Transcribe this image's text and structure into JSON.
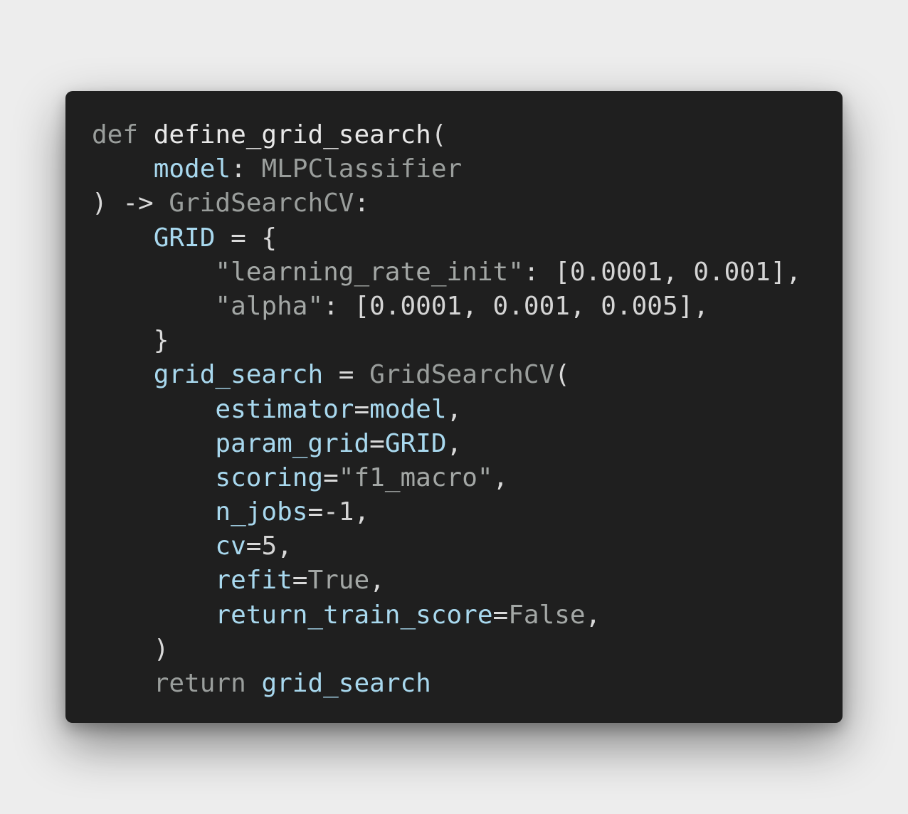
{
  "code_lines": [
    [
      {
        "t": "def",
        "c": "kw"
      },
      {
        "t": " ",
        "c": "punc"
      },
      {
        "t": "define_grid_search",
        "c": "fn"
      },
      {
        "t": "(",
        "c": "punc"
      }
    ],
    [
      {
        "t": "    ",
        "c": "punc"
      },
      {
        "t": "model",
        "c": "var"
      },
      {
        "t": ": ",
        "c": "punc"
      },
      {
        "t": "MLPClassifier",
        "c": "type"
      }
    ],
    [
      {
        "t": ") -> ",
        "c": "punc"
      },
      {
        "t": "GridSearchCV",
        "c": "type"
      },
      {
        "t": ":",
        "c": "punc"
      }
    ],
    [
      {
        "t": "    ",
        "c": "punc"
      },
      {
        "t": "GRID",
        "c": "var"
      },
      {
        "t": " = {",
        "c": "punc"
      }
    ],
    [
      {
        "t": "        ",
        "c": "punc"
      },
      {
        "t": "\"learning_rate_init\"",
        "c": "str"
      },
      {
        "t": ": [",
        "c": "punc"
      },
      {
        "t": "0.0001",
        "c": "num"
      },
      {
        "t": ", ",
        "c": "punc"
      },
      {
        "t": "0.001",
        "c": "num"
      },
      {
        "t": "],",
        "c": "punc"
      }
    ],
    [
      {
        "t": "        ",
        "c": "punc"
      },
      {
        "t": "\"alpha\"",
        "c": "str"
      },
      {
        "t": ": [",
        "c": "punc"
      },
      {
        "t": "0.0001",
        "c": "num"
      },
      {
        "t": ", ",
        "c": "punc"
      },
      {
        "t": "0.001",
        "c": "num"
      },
      {
        "t": ", ",
        "c": "punc"
      },
      {
        "t": "0.005",
        "c": "num"
      },
      {
        "t": "],",
        "c": "punc"
      }
    ],
    [
      {
        "t": "    }",
        "c": "punc"
      }
    ],
    [
      {
        "t": "    ",
        "c": "punc"
      },
      {
        "t": "grid_search",
        "c": "var"
      },
      {
        "t": " = ",
        "c": "punc"
      },
      {
        "t": "GridSearchCV",
        "c": "type"
      },
      {
        "t": "(",
        "c": "punc"
      }
    ],
    [
      {
        "t": "        ",
        "c": "punc"
      },
      {
        "t": "estimator",
        "c": "var"
      },
      {
        "t": "=",
        "c": "punc"
      },
      {
        "t": "model",
        "c": "var"
      },
      {
        "t": ",",
        "c": "punc"
      }
    ],
    [
      {
        "t": "        ",
        "c": "punc"
      },
      {
        "t": "param_grid",
        "c": "var"
      },
      {
        "t": "=",
        "c": "punc"
      },
      {
        "t": "GRID",
        "c": "var"
      },
      {
        "t": ",",
        "c": "punc"
      }
    ],
    [
      {
        "t": "        ",
        "c": "punc"
      },
      {
        "t": "scoring",
        "c": "var"
      },
      {
        "t": "=",
        "c": "punc"
      },
      {
        "t": "\"f1_macro\"",
        "c": "str"
      },
      {
        "t": ",",
        "c": "punc"
      }
    ],
    [
      {
        "t": "        ",
        "c": "punc"
      },
      {
        "t": "n_jobs",
        "c": "var"
      },
      {
        "t": "=",
        "c": "punc"
      },
      {
        "t": "-1",
        "c": "num"
      },
      {
        "t": ",",
        "c": "punc"
      }
    ],
    [
      {
        "t": "        ",
        "c": "punc"
      },
      {
        "t": "cv",
        "c": "var"
      },
      {
        "t": "=",
        "c": "punc"
      },
      {
        "t": "5",
        "c": "num"
      },
      {
        "t": ",",
        "c": "punc"
      }
    ],
    [
      {
        "t": "        ",
        "c": "punc"
      },
      {
        "t": "refit",
        "c": "var"
      },
      {
        "t": "=",
        "c": "punc"
      },
      {
        "t": "True",
        "c": "const"
      },
      {
        "t": ",",
        "c": "punc"
      }
    ],
    [
      {
        "t": "        ",
        "c": "punc"
      },
      {
        "t": "return_train_score",
        "c": "var"
      },
      {
        "t": "=",
        "c": "punc"
      },
      {
        "t": "False",
        "c": "const"
      },
      {
        "t": ",",
        "c": "punc"
      }
    ],
    [
      {
        "t": "    )",
        "c": "punc"
      }
    ],
    [
      {
        "t": "    ",
        "c": "punc"
      },
      {
        "t": "return",
        "c": "kw"
      },
      {
        "t": " ",
        "c": "punc"
      },
      {
        "t": "grid_search",
        "c": "var"
      }
    ]
  ]
}
